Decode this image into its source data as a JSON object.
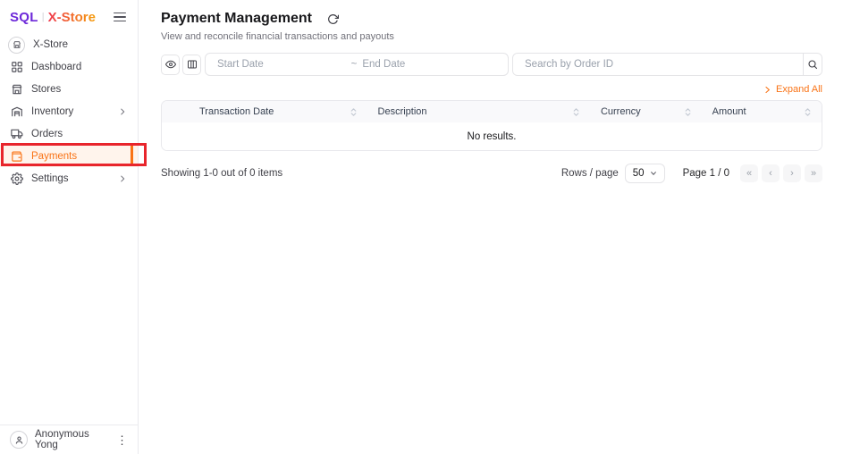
{
  "brand": {
    "sql": "SQL",
    "divider": "|",
    "name": "X-Store"
  },
  "sidebar": {
    "items": [
      {
        "label": "X-Store"
      },
      {
        "label": "Dashboard"
      },
      {
        "label": "Stores"
      },
      {
        "label": "Inventory"
      },
      {
        "label": "Orders"
      },
      {
        "label": "Payments"
      },
      {
        "label": "Settings"
      }
    ],
    "user_name": "Anonymous Yong"
  },
  "header": {
    "title": "Payment Management",
    "subtitle": "View and reconcile financial transactions and payouts"
  },
  "filters": {
    "start_date_placeholder": "Start Date",
    "separator": "~",
    "end_date_placeholder": "End Date",
    "search_placeholder": "Search by Order ID"
  },
  "table": {
    "expand_all": "Expand All",
    "columns": [
      {
        "label": "Transaction Date"
      },
      {
        "label": "Description"
      },
      {
        "label": "Currency"
      },
      {
        "label": "Amount"
      }
    ],
    "empty_text": "No results."
  },
  "pagination": {
    "showing": "Showing 1-0 out of 0 items",
    "rows_per_page_label": "Rows / page",
    "rows_per_page_value": "50",
    "page_label": "Page 1 / 0",
    "first": "«",
    "prev": "‹",
    "next": "›",
    "last": "»"
  },
  "icons": {
    "kebab": "⋮"
  },
  "colors": {
    "accent_orange": "#f97316",
    "active_bg": "#fff4ec",
    "annotation_red": "#e8252c",
    "logo_purple": "#6d28d9"
  }
}
